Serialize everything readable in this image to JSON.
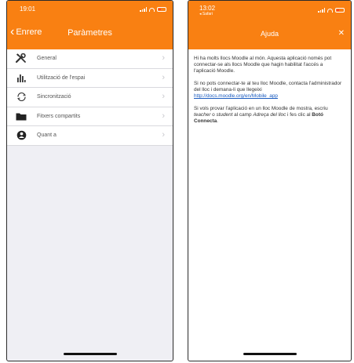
{
  "colors": {
    "accent": "#f98012",
    "link": "#1a5bbf"
  },
  "left": {
    "status_time": "19:01",
    "nav": {
      "back_label": "Enrere",
      "title": "Paràmetres"
    },
    "items": [
      {
        "icon": "wrench-screwdriver-icon",
        "label": "General"
      },
      {
        "icon": "bar-chart-icon",
        "label": "Utilització de l'espai"
      },
      {
        "icon": "sync-icon",
        "label": "Sincronització"
      },
      {
        "icon": "folder-icon",
        "label": "Fitxers compartits"
      },
      {
        "icon": "about-icon",
        "label": "Quant a"
      }
    ]
  },
  "right": {
    "status_time": "13:02",
    "status_back_app": "◂ Safari",
    "nav": {
      "title": "Ajuda",
      "close": "✕"
    },
    "paragraphs": {
      "p1": "Hi ha molts llocs Moodle al món. Aquesta aplicació només pot connectar-se als llocs Moodle que hagin habilitat l'accés a l'aplicació Moodle.",
      "p2_text": "Si no pots connectar-te al teu lloc Moodle, contacta l'administrador del lloc i demana-li que llegeixi",
      "p2_link": "http://docs.moodle.org/en/Mobile_app",
      "p3_a": "Si vols provar l'aplicació en un lloc Moodle de mostra, escriu ",
      "p3_teacher": "teacher",
      "p3_o": " o ",
      "p3_student": "student",
      "p3_b": " al camp ",
      "p3_field": "Adreça del lloc",
      "p3_c": " i fes clic al ",
      "p3_button": "Botó Connecta",
      "p3_end": "."
    }
  }
}
